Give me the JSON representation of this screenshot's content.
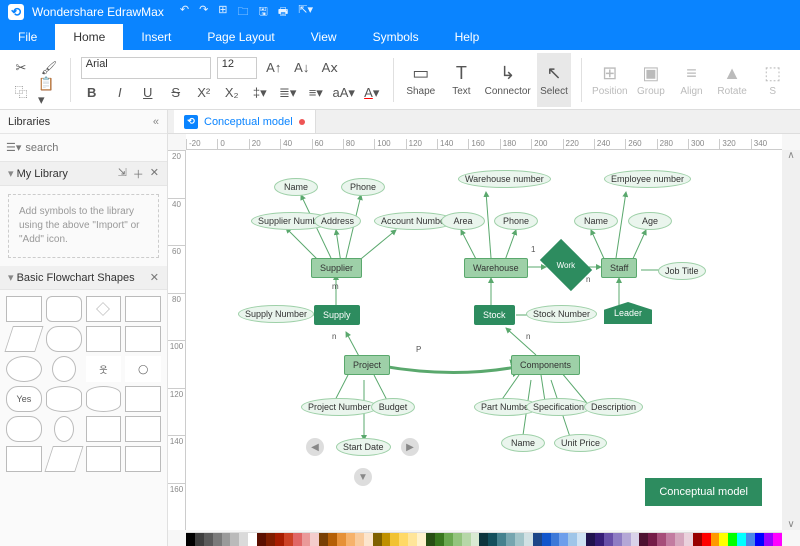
{
  "app": {
    "name": "Wondershare EdrawMax"
  },
  "qat": [
    "↶",
    "↷",
    "⊞",
    "🗀",
    "🖫",
    "🖶",
    "⇱▾"
  ],
  "menu": {
    "items": [
      "File",
      "Home",
      "Insert",
      "Page Layout",
      "View",
      "Symbols",
      "Help"
    ],
    "active": "Home"
  },
  "ribbon": {
    "font": "Arial",
    "size": "12",
    "groups": {
      "shape": "Shape",
      "text": "Text",
      "connector": "Connector",
      "select": "Select",
      "position": "Position",
      "group": "Group",
      "align": "Align",
      "rotate": "Rotate",
      "size": "S"
    }
  },
  "sidebar": {
    "title": "Libraries",
    "search_placeholder": "search",
    "mylib": "My Library",
    "mylib_hint": "Add symbols to the library using the above \"Import\" or \"Add\" icon.",
    "basic": "Basic Flowchart Shapes",
    "yes_label": "Yes"
  },
  "doc": {
    "tab": "Conceptual model"
  },
  "ruler": {
    "h": [
      "-20",
      "0",
      "20",
      "40",
      "60",
      "80",
      "100",
      "120",
      "140",
      "160",
      "180",
      "200",
      "220",
      "240",
      "260",
      "280",
      "300",
      "320",
      "340"
    ],
    "v": [
      "20",
      "40",
      "60",
      "80",
      "100",
      "120",
      "140",
      "160"
    ]
  },
  "diagram": {
    "title": "Conceptual model",
    "entities": {
      "supplier": "Supplier",
      "supply": "Supply",
      "project": "Project",
      "warehouse": "Warehouse",
      "stock": "Stock",
      "components": "Components",
      "staff": "Staff",
      "work": "Work",
      "leader": "Leader"
    },
    "attrs": {
      "name1": "Name",
      "phone1": "Phone",
      "supplier_number": "Supplier Number",
      "address": "Address",
      "account_number": "Account Number",
      "supply_number": "Supply Number",
      "project_number": "Project Number",
      "budget": "Budget",
      "start_date": "Start Date",
      "warehouse_number": "Warehouse number",
      "area": "Area",
      "phone2": "Phone",
      "stock_number": "Stock Number",
      "part_number": "Part Number",
      "specification": "Specification",
      "description": "Description",
      "name3": "Name",
      "unit_price": "Unit Price",
      "employee_number": "Employee number",
      "name2": "Name",
      "age": "Age",
      "job_title": "Job Title"
    },
    "labels": {
      "m": "m",
      "n": "n",
      "p": "P",
      "one": "1"
    }
  },
  "palette": [
    "#000000",
    "#3d3d3d",
    "#5a5a5a",
    "#7a7a7a",
    "#9a9a9a",
    "#bababa",
    "#dadada",
    "#ffffff",
    "#5b0f00",
    "#7f1d00",
    "#a61c00",
    "#cc4125",
    "#e06666",
    "#ea9999",
    "#f4cccc",
    "#783f04",
    "#b45f06",
    "#e69138",
    "#f6b26b",
    "#f9cb9c",
    "#fce5cd",
    "#7f6000",
    "#bf9000",
    "#f1c232",
    "#ffd966",
    "#ffe599",
    "#fff2cc",
    "#274e13",
    "#38761d",
    "#6aa84f",
    "#93c47d",
    "#b6d7a8",
    "#d9ead3",
    "#0c343d",
    "#134f5c",
    "#45818e",
    "#76a5af",
    "#a2c4c9",
    "#d0e0e3",
    "#1c4587",
    "#1155cc",
    "#3c78d8",
    "#6d9eeb",
    "#9fc5e8",
    "#cfe2f3",
    "#20124d",
    "#351c75",
    "#674ea7",
    "#8e7cc3",
    "#b4a7d6",
    "#d9d2e9",
    "#4c1130",
    "#741b47",
    "#a64d79",
    "#c27ba0",
    "#d5a6bd",
    "#ead1dc",
    "#980000",
    "#ff0000",
    "#ff9900",
    "#ffff00",
    "#00ff00",
    "#00ffff",
    "#4a86e8",
    "#0000ff",
    "#9900ff",
    "#ff00ff"
  ]
}
